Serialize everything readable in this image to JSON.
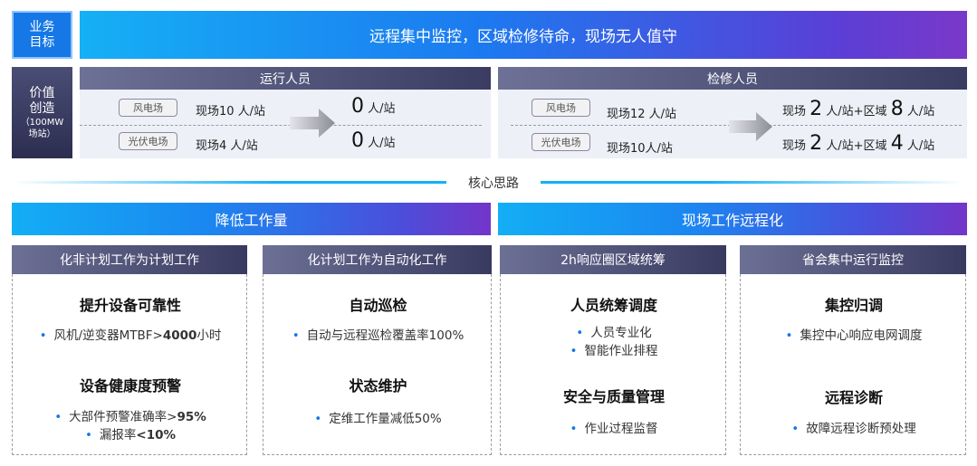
{
  "row1": {
    "tag": "业务目标",
    "tag_line1": "业务",
    "tag_line2": "目标",
    "banner": "远程集中监控，区域检修待命，现场无人值守"
  },
  "row2": {
    "tag_line1": "价值",
    "tag_line2": "创造",
    "tag_sub1": "（100MW",
    "tag_sub2": "场站）",
    "left_panel": {
      "title": "运行人员",
      "rows": [
        {
          "pill": "风电场",
          "current": "现场10 人/站",
          "target_num": "0",
          "target_unit": " 人/站"
        },
        {
          "pill": "光伏电场",
          "current": "现场4 人/站",
          "target_num": "0",
          "target_unit": " 人/站"
        }
      ]
    },
    "right_panel": {
      "title": "检修人员",
      "rows": [
        {
          "pill": "风电场",
          "current": "现场12 人/站",
          "t1": "现场 ",
          "n1": "2",
          "t2": " 人/站+区域 ",
          "n2": "8",
          "t3": " 人/站"
        },
        {
          "pill": "光伏电场",
          "current": "现场10人/站",
          "t1": "现场 ",
          "n1": "2",
          "t2": " 人/站+区域 ",
          "n2": "4",
          "t3": " 人/站"
        }
      ]
    }
  },
  "divider": "核心思路",
  "sections": {
    "left_title": "降低工作量",
    "right_title": "现场工作远程化"
  },
  "cards": [
    {
      "head": "化非计划工作为计划工作",
      "h1": "提升设备可靠性",
      "b1_prefix": "风机/逆变器MTBF>",
      "b1_bold": "4000",
      "b1_suffix": "小时",
      "h2": "设备健康度预警",
      "b2_prefix": "大部件预警准确率>",
      "b2_bold": "95%",
      "b3_prefix": "漏报率",
      "b3_bold": "<10%"
    },
    {
      "head": "化计划工作为自动化工作",
      "h1": "自动巡检",
      "b1": "自动与远程巡检覆盖率100%",
      "h2": "状态维护",
      "b2": "定维工作量减低50%"
    },
    {
      "head": "2h响应圈区域统筹",
      "h1": "人员统筹调度",
      "b1": "人员专业化",
      "b2": "智能作业排程",
      "h2": "安全与质量管理",
      "b3": "作业过程监督"
    },
    {
      "head": "省会集中运行监控",
      "h1": "集控归调",
      "b1": "集控中心响应电网调度",
      "h2": "远程诊断",
      "b2": "故障远程诊断预处理"
    }
  ],
  "colors": {
    "accent_blue": "#1677e6",
    "navy": "#3a3c62",
    "gradient_start": "#15b0f5",
    "gradient_end": "#7a38c9"
  },
  "icons": {
    "arrow": "right-arrow-icon",
    "bullet": "bullet-dot-icon"
  }
}
